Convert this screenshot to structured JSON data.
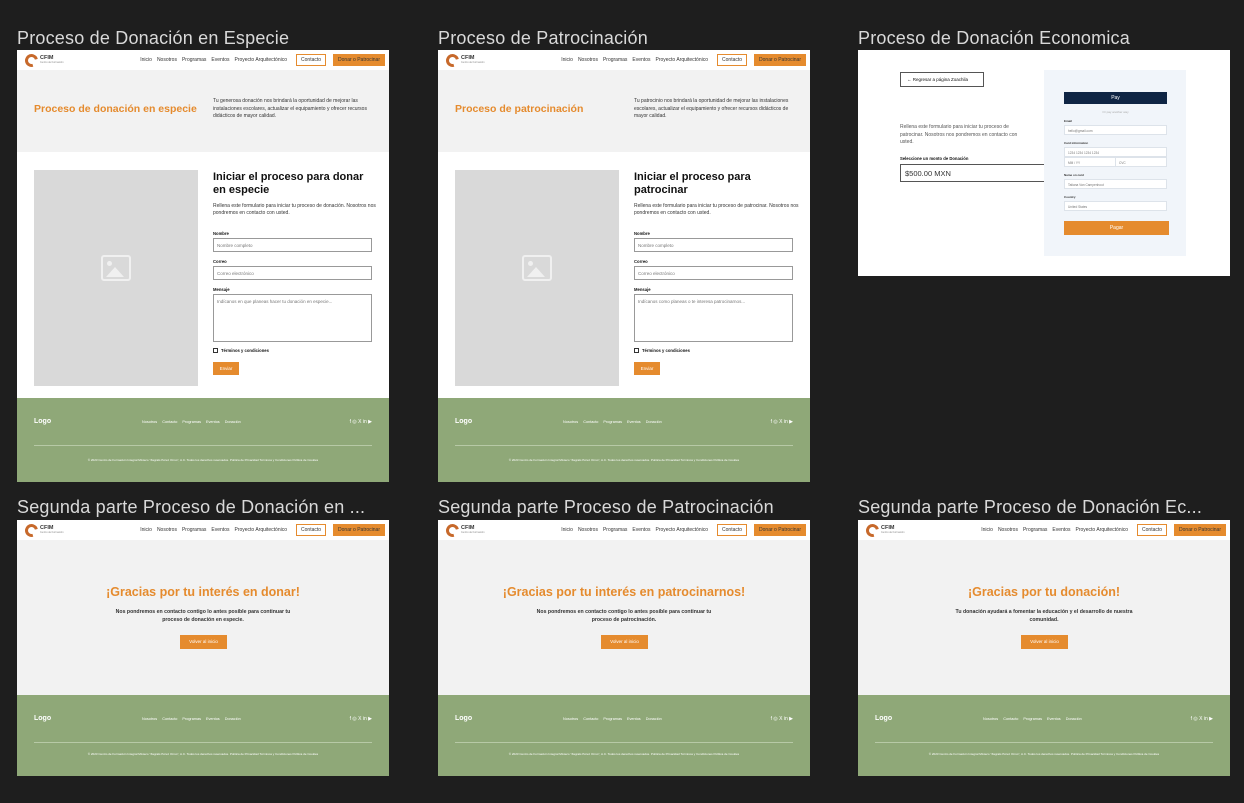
{
  "frames": {
    "f1": {
      "title": "Proceso de Donación en Especie"
    },
    "f2": {
      "title": "Proceso de Patrocinación"
    },
    "f3": {
      "title": "Proceso de Donación Economica"
    },
    "f4": {
      "title": "Segunda parte Proceso de Donación en ..."
    },
    "f5": {
      "title": "Segunda parte Proceso de Patrocinación"
    },
    "f6": {
      "title": "Segunda parte Proceso de Donación Ec..."
    }
  },
  "nav": {
    "logo_text": "CFIM",
    "logo_sub": "Centro de Formación",
    "links": [
      "Inicio",
      "Nosotros",
      "Programas",
      "Eventos",
      "Proyecto Arquitectónico"
    ],
    "contact_label": "Contacto",
    "donate_label": "Donar o Patrocinar"
  },
  "especie": {
    "hero_title": "Proceso de donación en especie",
    "hero_text": "Tu generosa donación nos brindará la oportunidad de mejorar las instalaciones escolares, actualizar el equipamiento y ofrecer recursos didácticos de mayor calidad.",
    "form_title": "Iniciar el proceso para donar en especie",
    "form_sub": "Rellena este formulario para iniciar tu proceso de donación. Nosotros nos pondremos en contacto con usted.",
    "message_placeholder": "Indícanos en que planeas hacer tu donación en especie..."
  },
  "patrocinio": {
    "hero_title": "Proceso de patrocinación",
    "hero_text": "Tu patrocinio nos brindará la oportunidad de mejorar las instalaciones escolares, actualizar el equipamiento y ofrecer recursos didácticos de mayor calidad.",
    "form_title": "Iniciar el proceso para patrocinar",
    "form_sub": "Rellena este formulario para iniciar tu proceso de patrocinar. Nosotros nos pondremos en contacto con usted.",
    "message_placeholder": "Indícanos como planeas o te interesa patrocinarnos..."
  },
  "form": {
    "name_label": "Nombre",
    "name_placeholder": "Nombre completo",
    "email_label": "Correo",
    "email_placeholder": "Correo electrónico",
    "message_label": "Mensaje",
    "terms_label": "Términos y condiciones",
    "submit_label": "Enviar"
  },
  "economica": {
    "back_label": "← Regresar a página Zoachila",
    "description": "Rellena este formulario para iniciar tu proceso de patrocinar. Nosotros nos pondremos en contacto con usted.",
    "amount_label": "Seleccione un monto de Donación",
    "amount_value": "$500.00 MXN",
    "apple_pay_label": " Pay",
    "or_text": "Or pay another way",
    "email_label": "Email",
    "email_value": "hello@gmail.com",
    "card_label": "Card information",
    "card_placeholder": "1234 1234 1234 1234",
    "expiry_placeholder": "MM / YY",
    "cvc_placeholder": "CVC",
    "name_label": "Name on card",
    "name_value": "Tatiana Van Campenhout",
    "country_label": "Country",
    "country_value": "United States",
    "pay_label": "Pagar"
  },
  "thanks": {
    "especie_title": "¡Gracias por tu interés en donar!",
    "especie_text": "Nos pondremos en contacto contigo lo antes posible para continuar tu proceso de donación en especie.",
    "patrocinio_title": "¡Gracias por tu interés en patrocinarnos!",
    "patrocinio_text": "Nos pondremos en contacto contigo lo antes posible para continuar tu proceso de patrocinación.",
    "economica_title": "¡Gracias por tu donación!",
    "economica_text": "Tu donación ayudará a fomentar la educación y el desarrollo de nuestra comunidad.",
    "button_label": "Volver al inicio"
  },
  "footer": {
    "logo": "Logo",
    "links": [
      "Nosotros",
      "Contacto",
      "Programas",
      "Eventos",
      "Donación"
    ],
    "social": "f ◎ X in ▶",
    "copyright": "© 2023 Centro de Formación Integral Mixteco \"Zagrals Pérez Ormo\", A.C. Todos los derechos reservados.   Política de Privacidad   Términos y Condiciones   Política de Cookies"
  },
  "colors": {
    "accent": "#e58b2e",
    "footer": "#8fa878",
    "canvas": "#1e1e1e",
    "navy": "#0f2544"
  }
}
